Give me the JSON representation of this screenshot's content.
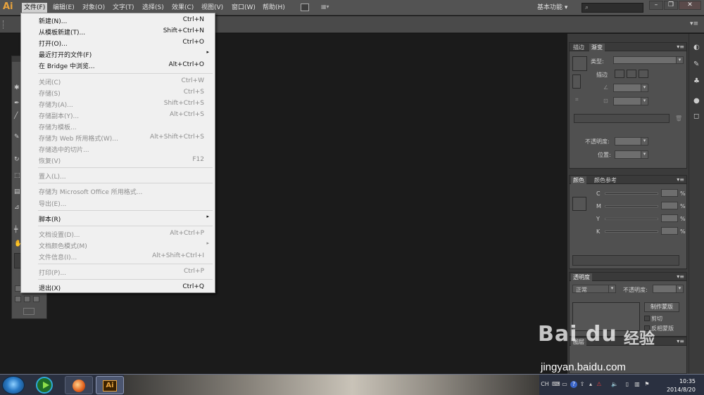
{
  "app": {
    "logo_text": "Ai"
  },
  "menubar": {
    "items": [
      "文件(F)",
      "编辑(E)",
      "对象(O)",
      "文字(T)",
      "选择(S)",
      "效果(C)",
      "视图(V)",
      "窗口(W)",
      "帮助(H)"
    ],
    "active_index": 0,
    "workspace": "基本功能 ▾",
    "search_icon": "search-icon",
    "window_buttons": [
      "–",
      "❐",
      "✕"
    ]
  },
  "file_menu": {
    "items": [
      {
        "label": "新建(N)...",
        "shortcut": "Ctrl+N",
        "enabled": true
      },
      {
        "label": "从模板新建(T)...",
        "shortcut": "Shift+Ctrl+N",
        "enabled": true
      },
      {
        "label": "打开(O)...",
        "shortcut": "Ctrl+O",
        "enabled": true
      },
      {
        "label": "最近打开的文件(F)",
        "shortcut": "",
        "enabled": true,
        "submenu": true
      },
      {
        "label": "在 Bridge 中浏览...",
        "shortcut": "Alt+Ctrl+O",
        "enabled": true
      },
      {
        "label": "关闭(C)",
        "shortcut": "Ctrl+W",
        "enabled": false,
        "sep_before": true
      },
      {
        "label": "存储(S)",
        "shortcut": "Ctrl+S",
        "enabled": false
      },
      {
        "label": "存储为(A)...",
        "shortcut": "Shift+Ctrl+S",
        "enabled": false
      },
      {
        "label": "存储副本(Y)...",
        "shortcut": "Alt+Ctrl+S",
        "enabled": false
      },
      {
        "label": "存储为模板...",
        "shortcut": "",
        "enabled": false
      },
      {
        "label": "存储为 Web 所用格式(W)...",
        "shortcut": "Alt+Shift+Ctrl+S",
        "enabled": false
      },
      {
        "label": "存储选中的切片...",
        "shortcut": "",
        "enabled": false
      },
      {
        "label": "恢复(V)",
        "shortcut": "F12",
        "enabled": false
      },
      {
        "label": "置入(L)...",
        "shortcut": "",
        "enabled": false,
        "sep_before": true
      },
      {
        "label": "存储为 Microsoft Office 所用格式...",
        "shortcut": "",
        "enabled": false,
        "sep_before": true
      },
      {
        "label": "导出(E)...",
        "shortcut": "",
        "enabled": false
      },
      {
        "label": "脚本(R)",
        "shortcut": "",
        "enabled": true,
        "submenu": true,
        "sep_before": true
      },
      {
        "label": "文档设置(D)...",
        "shortcut": "Alt+Ctrl+P",
        "enabled": false,
        "sep_before": true
      },
      {
        "label": "文档颜色模式(M)",
        "shortcut": "",
        "enabled": false,
        "submenu": true
      },
      {
        "label": "文件信息(I)...",
        "shortcut": "Alt+Shift+Ctrl+I",
        "enabled": false
      },
      {
        "label": "打印(P)...",
        "shortcut": "Ctrl+P",
        "enabled": false,
        "sep_before": true
      },
      {
        "label": "退出(X)",
        "shortcut": "Ctrl+Q",
        "enabled": true,
        "sep_before": true
      }
    ]
  },
  "gradient_panel": {
    "tabs": [
      "描边",
      "渐变"
    ],
    "type_label": "类型:",
    "stroke_label": "描边",
    "opacity_label": "不透明度:",
    "position_label": "位置:"
  },
  "color_panel": {
    "tabs": [
      "颜色",
      "颜色参考"
    ],
    "channels": [
      "C",
      "M",
      "Y",
      "K"
    ],
    "unit": "%"
  },
  "transparency_panel": {
    "tab": "透明度",
    "blend_mode": "正常",
    "opacity_label": "不透明度:",
    "make_mask_button": "制作蒙版",
    "clip_label": "剪切",
    "invert_mask_label": "反相蒙版"
  },
  "bottom_panel": {
    "tab": "图层"
  },
  "taskbar": {
    "ime": "CH",
    "clock_time": "10:35",
    "clock_date": "2014/8/20"
  },
  "watermark": {
    "logo": "Bai du",
    "cn": "经验",
    "url": "jingyan.baidu.com"
  },
  "colors": {
    "menubar_bg": "#535353",
    "panel_bg": "#505050",
    "canvas_bg": "#1b1b1b",
    "menu_bg": "#f0f0f0",
    "accent_ai": "#e8a33d"
  }
}
